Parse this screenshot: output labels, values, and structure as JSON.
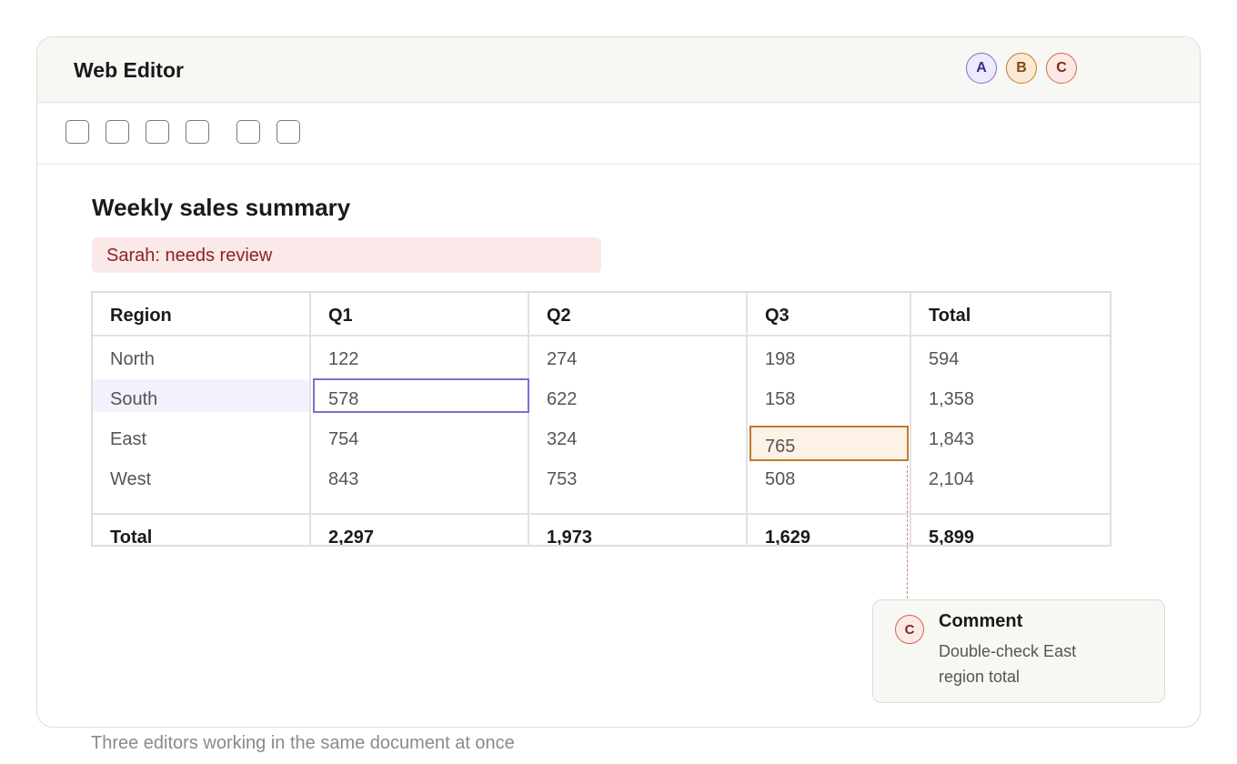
{
  "app": {
    "title": "Web Editor"
  },
  "collaborators": [
    {
      "initial": "A",
      "bg": "#eceafb",
      "border": "#7b6fd0",
      "fg": "#3b2e8a"
    },
    {
      "initial": "B",
      "bg": "#fbe9d3",
      "border": "#c07a2c",
      "fg": "#7a4a10"
    },
    {
      "initial": "C",
      "bg": "#fce8e4",
      "border": "#d06a4e",
      "fg": "#7a2a1a"
    }
  ],
  "document": {
    "title": "Weekly sales summary",
    "review_note": "Sarah: needs review"
  },
  "table": {
    "headers": [
      "Region",
      "Q1",
      "Q2",
      "Q3",
      "Total"
    ],
    "rows": [
      [
        "North",
        "122",
        "274",
        "198",
        "594"
      ],
      [
        "South",
        "578",
        "622",
        "158",
        "1,358"
      ],
      [
        "East",
        "754",
        "324",
        "765",
        "1,843"
      ],
      [
        "West",
        "843",
        "753",
        "508",
        "2,104"
      ]
    ],
    "totals": [
      "Total",
      "2,297",
      "1,973",
      "1,629",
      "5,899"
    ]
  },
  "comment": {
    "author_initial": "C",
    "title": "Comment",
    "body": "Double-check East region total"
  },
  "caption": "Three editors working in the same document at once"
}
